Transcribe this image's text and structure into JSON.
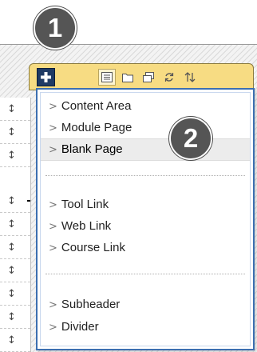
{
  "toolbar": {
    "add_icon": "plus-icon",
    "tools": [
      {
        "name": "list-icon",
        "selected": true
      },
      {
        "name": "folder-icon",
        "selected": false
      },
      {
        "name": "window-icon",
        "selected": false
      },
      {
        "name": "refresh-icon",
        "selected": false
      },
      {
        "name": "sort-icon",
        "selected": false
      }
    ],
    "background_color": "#f7dc83",
    "add_button_color": "#1f3a64"
  },
  "badges": {
    "step1": "1",
    "step2": "2",
    "color": "#555555"
  },
  "menu": {
    "border_color": "#3c6fb0",
    "groups": [
      {
        "items": [
          {
            "label": "Content Area",
            "active": false
          },
          {
            "label": "Module Page",
            "active": false
          },
          {
            "label": "Blank Page",
            "active": true
          }
        ]
      },
      {
        "items": [
          {
            "label": "Tool Link",
            "active": false
          },
          {
            "label": "Web Link",
            "active": false
          },
          {
            "label": "Course Link",
            "active": false
          }
        ]
      },
      {
        "items": [
          {
            "label": "Subheader",
            "active": false
          },
          {
            "label": "Divider",
            "active": false
          }
        ]
      }
    ]
  },
  "rail": {
    "handle_icon": "drag-handle-icon",
    "handle_glyph": "↕"
  }
}
